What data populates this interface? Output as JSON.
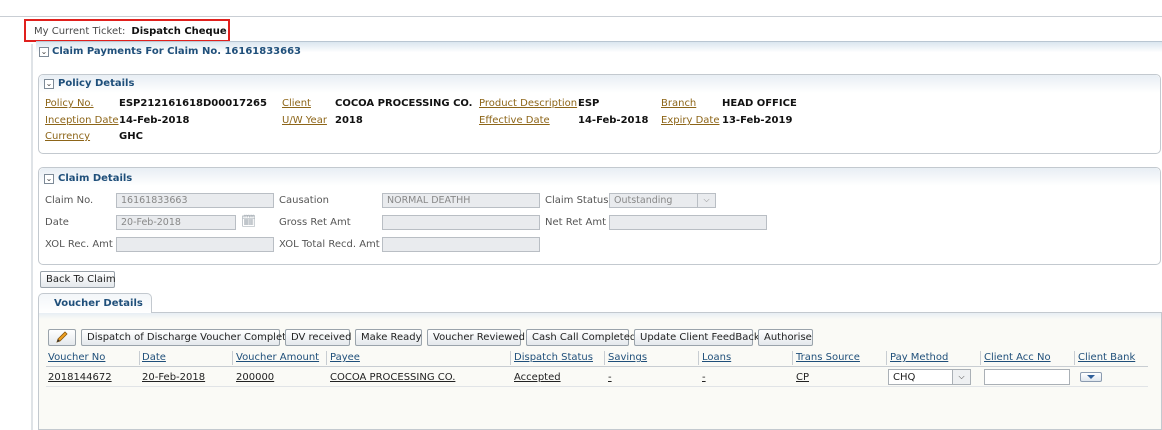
{
  "ticket": {
    "label": "My Current Ticket:",
    "value": "Dispatch Cheque"
  },
  "claim_header": {
    "title": "Claim Payments For Claim No. 16161833663",
    "toggle": "⌄"
  },
  "policy": {
    "title": "Policy Details",
    "policy_no_label": "Policy No.",
    "policy_no": "ESP212161618D00017265",
    "client_label": "Client",
    "client": "COCOA PROCESSING CO.",
    "product_label": "Product Description",
    "product": "ESP",
    "branch_label": "Branch",
    "branch": "HEAD OFFICE",
    "inception_label": "Inception Date",
    "inception": "14-Feb-2018",
    "uw_year_label": "U/W Year",
    "uw_year": "2018",
    "effective_label": "Effective Date",
    "effective": "14-Feb-2018",
    "expiry_label": "Expiry Date",
    "expiry": "13-Feb-2019",
    "currency_label": "Currency",
    "currency": "GHC"
  },
  "claim": {
    "title": "Claim Details",
    "claim_no_label": "Claim No.",
    "claim_no": "16161833663",
    "causation_label": "Causation",
    "causation": "NORMAL DEATHH",
    "status_label": "Claim Status",
    "status": "Outstanding",
    "date_label": "Date",
    "date": "20-Feb-2018",
    "gross_label": "Gross Ret Amt",
    "gross": "",
    "net_label": "Net Ret Amt",
    "net": "",
    "xol_label": "XOL Rec. Amt",
    "xol": "",
    "xol_total_label": "XOL Total Recd. Amt",
    "xol_total": ""
  },
  "back_button": "Back To Claim",
  "tab_label": "Voucher Details",
  "toolbar": {
    "b1": "Dispatch of Discharge Voucher Completed",
    "b2": "DV received",
    "b3": "Make Ready",
    "b4": "Voucher Reviewed",
    "b5": "Cash Call Completed",
    "b6": "Update Client FeedBack",
    "b7": "Authorise"
  },
  "table": {
    "headers": [
      "Voucher No",
      "Date",
      "Voucher Amount",
      "Payee",
      "Dispatch Status",
      "Savings",
      "Loans",
      "Trans Source",
      "Pay Method",
      "Client Acc No",
      "Client Bank"
    ],
    "rows": [
      [
        "2018144672",
        "20-Feb-2018",
        "200000",
        "COCOA PROCESSING CO.",
        "Accepted",
        "-",
        "-",
        "CP",
        "CHQ",
        "",
        ""
      ]
    ]
  },
  "colors": {
    "accent": "#1f4f7a",
    "link": "#8d6518",
    "highlight_border": "#e0201d"
  }
}
